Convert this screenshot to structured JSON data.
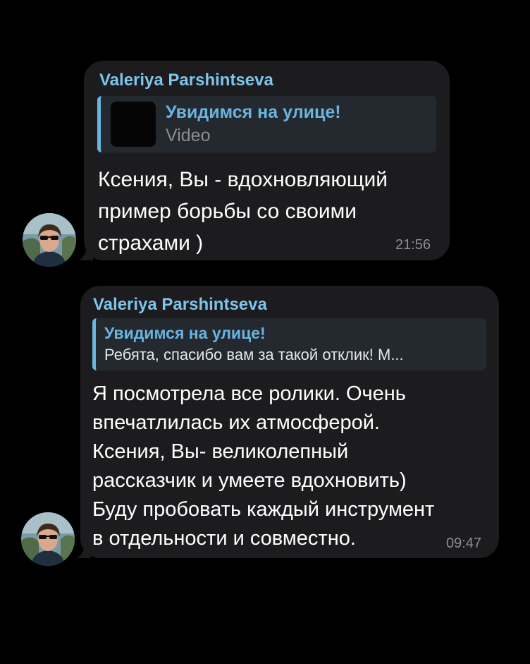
{
  "messages": [
    {
      "sender": "Valeriya Parshintseva",
      "reply": {
        "title": "Увидимся на улице!",
        "subtitle": "Video",
        "has_thumbnail": true
      },
      "text": "Ксения,  Вы - вдохновляющий\nпример борьбы со своими\nстрахами )",
      "time": "21:56"
    },
    {
      "sender": "Valeriya Parshintseva",
      "reply": {
        "title": "Увидимся на улице!",
        "subtitle": "Ребята, спасибо вам за такой отклик! М...",
        "has_thumbnail": false
      },
      "text": "Я посмотрела все ролики. Очень\nвпечатлилась их атмосферой.\nКсения,  Вы- великолепный\nрассказчик и умеете вдохновить)\nБуду пробовать каждый инструмент\nв отдельности и совместно.",
      "time": "09:47"
    }
  ],
  "colors": {
    "background": "#000000",
    "bubble": "#1c1c1e",
    "sender_name": "#7fc4ea",
    "reply_accent": "#6ab4e0",
    "reply_background": "#23292f",
    "timestamp": "#8d8d93"
  }
}
